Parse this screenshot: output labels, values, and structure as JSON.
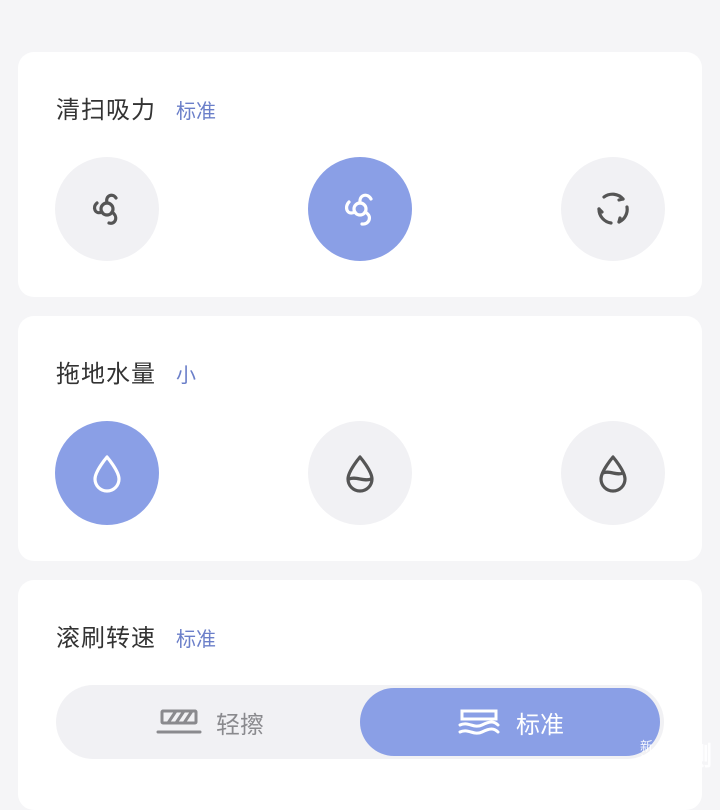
{
  "suction": {
    "title": "清扫吸力",
    "value": "标准",
    "options": [
      {
        "icon": "fan-quiet-icon",
        "active": false
      },
      {
        "icon": "fan-standard-icon",
        "active": true
      },
      {
        "icon": "fan-strong-icon",
        "active": false
      }
    ]
  },
  "water": {
    "title": "拖地水量",
    "value": "小",
    "options": [
      {
        "icon": "water-drop-low-icon",
        "active": true
      },
      {
        "icon": "water-drop-medium-icon",
        "active": false
      },
      {
        "icon": "water-drop-high-icon",
        "active": false
      }
    ]
  },
  "brush": {
    "title": "滚刷转速",
    "value": "标准",
    "options": [
      {
        "label": "轻擦",
        "icon": "mop-light-icon",
        "active": false
      },
      {
        "label": "标准",
        "icon": "mop-standard-icon",
        "active": true
      }
    ]
  },
  "watermark": {
    "small": "新浪",
    "big": "众测"
  },
  "colors": {
    "accent": "#8a9fe6",
    "value_text": "#6b7fc9",
    "option_bg": "#f1f1f4"
  }
}
